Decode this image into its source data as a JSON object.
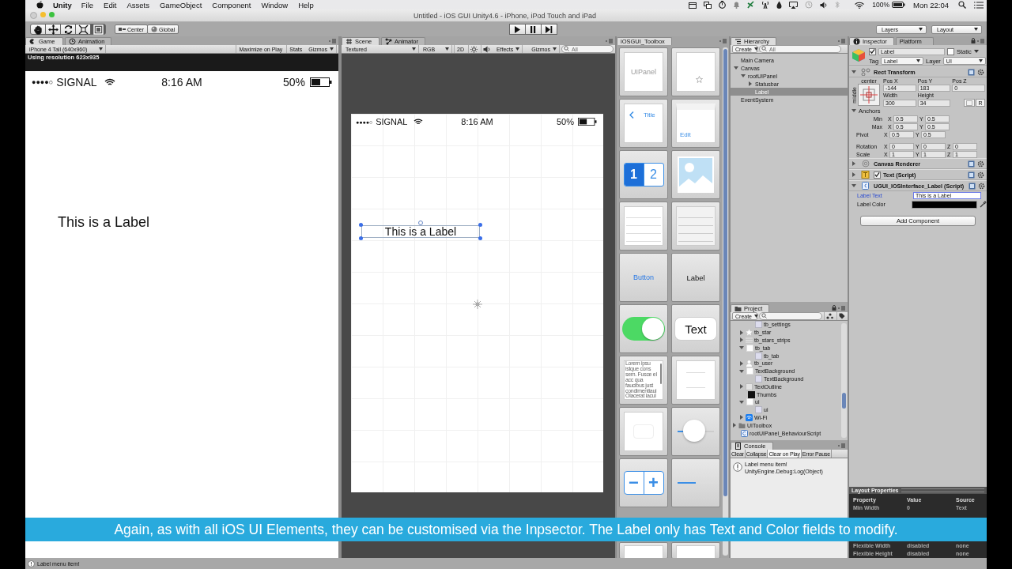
{
  "menubar": {
    "app": "Unity",
    "menus": [
      "File",
      "Edit",
      "Assets",
      "GameObject",
      "Component",
      "Window",
      "Help"
    ],
    "battery_text": "100%",
    "clock": "Mon 22:04"
  },
  "window": {
    "title": "Untitled - iOS GUI Unity4.6 - iPhone, iPod Touch and iPad"
  },
  "toolbar": {
    "tools": [
      {
        "kind": "hand",
        "selected": false
      },
      {
        "kind": "move",
        "selected": false
      },
      {
        "kind": "rotate",
        "selected": false
      },
      {
        "kind": "scale",
        "selected": false
      },
      {
        "kind": "rect",
        "selected": true
      }
    ],
    "pivot_buttons": [
      {
        "kind": "center",
        "label": "Center"
      },
      {
        "kind": "global",
        "label": "Global"
      }
    ],
    "playback": [
      {
        "kind": "play"
      },
      {
        "kind": "pause"
      },
      {
        "kind": "step"
      }
    ],
    "dropdowns": [
      "Layers",
      "Layout"
    ]
  },
  "game": {
    "tabs": [
      {
        "kind": "game",
        "label": "Game",
        "selected": true
      },
      {
        "kind": "animation",
        "label": "Animation",
        "selected": false
      }
    ],
    "resolution": "iPhone 4 Tall (640x960)",
    "buttons": [
      "Maximize on Play",
      "Stats"
    ],
    "gizmos": "Gizmos",
    "info": "Using resolution 623x935",
    "phone": {
      "signal_dots": "●●●●○",
      "carrier": "SIGNAL",
      "time": "8:16 AM",
      "battery": "50%",
      "label": "This is a Label"
    }
  },
  "scene": {
    "tabs": [
      {
        "kind": "scene",
        "label": "Scene",
        "selected": true
      },
      {
        "kind": "animator",
        "label": "Animator",
        "selected": false
      }
    ],
    "render_mode": "Textured",
    "channel": "RGB",
    "mode_button": "2D",
    "effects": "Effects",
    "gizmos": "Gizmos",
    "search_placeholder": "All",
    "phone": {
      "signal_dots": "●●●●○",
      "carrier": "SIGNAL",
      "time": "8:16 AM",
      "battery": "50%",
      "label": "This is a Label"
    }
  },
  "toolbox": {
    "tab": "iOSGUI_Toolbox",
    "tiles": [
      {
        "kind": "panel",
        "text": "UIPanel"
      },
      {
        "kind": "tabbar"
      },
      {
        "kind": "navbar",
        "text": "Title"
      },
      {
        "kind": "edit",
        "text": "Edit"
      },
      {
        "kind": "segmented",
        "texts": [
          "1",
          "2"
        ]
      },
      {
        "kind": "image"
      },
      {
        "kind": "table"
      },
      {
        "kind": "table_grey"
      },
      {
        "kind": "button",
        "text": "Button"
      },
      {
        "kind": "label",
        "text": "Label"
      },
      {
        "kind": "switch",
        "on": true
      },
      {
        "kind": "textfield",
        "text": "Text"
      },
      {
        "kind": "textview",
        "text": "Lorem ipsu istque cons sem. Fusce el acc qua faucibus just condimentiaui Olacerat iacul"
      },
      {
        "kind": "picker"
      },
      {
        "kind": "frame"
      },
      {
        "kind": "slider",
        "level": 0.45
      },
      {
        "kind": "stepper",
        "texts": [
          "−",
          "+"
        ]
      },
      {
        "kind": "progress",
        "level": 0.5
      },
      {
        "kind": "blank"
      },
      {
        "kind": "blank"
      }
    ]
  },
  "hierarchy": {
    "tab": "Hierarchy",
    "create": "Create",
    "search_placeholder": "All",
    "items": [
      {
        "label": "Main Camera",
        "selected": false
      },
      {
        "label": "Canvas",
        "selected": false,
        "expanded": true,
        "children": [
          {
            "label": "rootUIPanel",
            "selected": false,
            "expanded": true,
            "children": [
              {
                "label": "Statusbar",
                "selected": false,
                "expanded": false
              },
              {
                "label": "Label",
                "selected": true
              }
            ]
          }
        ]
      },
      {
        "label": "EventSystem",
        "selected": false
      }
    ]
  },
  "project": {
    "tab": "Project",
    "create": "Create",
    "scrolled_items": [
      {
        "kind": "sprite",
        "label": "tb_settings"
      },
      {
        "kind": "star",
        "label": "tb_star",
        "expanded": false
      },
      {
        "kind": "strips",
        "label": "tb_stars_strips",
        "expanded": false
      },
      {
        "kind": "texture",
        "label": "tb_tab",
        "expanded": true,
        "children": [
          {
            "kind": "sprite",
            "label": "tb_tab"
          }
        ]
      },
      {
        "kind": "user",
        "label": "tb_user",
        "expanded": false
      },
      {
        "kind": "texture",
        "label": "TextBackground",
        "expanded": true,
        "children": [
          {
            "kind": "sprite",
            "label": "TextBackground"
          }
        ]
      },
      {
        "kind": "outline",
        "label": "TextOutline",
        "expanded": false
      },
      {
        "kind": "black",
        "label": "Thumbs"
      },
      {
        "kind": "texture",
        "label": "ui",
        "expanded": true,
        "children": [
          {
            "kind": "sprite",
            "label": "ui"
          }
        ]
      },
      {
        "kind": "wifi",
        "label": "Wi-Fi",
        "expanded": false
      }
    ],
    "items": [
      {
        "kind": "folder",
        "label": "UIToolbox",
        "expanded": false
      },
      {
        "kind": "script",
        "label": "rootUIPanel_BehaviourScript"
      }
    ]
  },
  "console": {
    "tab": "Console",
    "buttons": [
      {
        "label": "Clear",
        "selected": false
      },
      {
        "label": "Collapse",
        "selected": false
      },
      {
        "label": "Clear on Play",
        "selected": true
      },
      {
        "label": "Error Pause",
        "selected": false
      }
    ],
    "entries": [
      {
        "lines": [
          "Label menu item!",
          "UnityEngine.Debug:Log(Object)"
        ]
      }
    ]
  },
  "inspector": {
    "tabs": [
      {
        "kind": "inspector",
        "label": "Inspector",
        "selected": true
      },
      {
        "kind": "platform",
        "label": "Platform",
        "selected": false
      }
    ],
    "active": true,
    "name": "Label",
    "static": {
      "label": "Static",
      "checked": false
    },
    "tag_label": "Tag",
    "tag": "Label",
    "layer_label": "Layer",
    "layer": "UI",
    "rect_transform": {
      "title": "Rect Transform",
      "expanded": true,
      "anchor_h": "center",
      "anchor_v": "middle",
      "fields": [
        {
          "label": "Pos X",
          "value": "-144"
        },
        {
          "label": "Pos Y",
          "value": "183"
        },
        {
          "label": "Pos Z",
          "value": "0"
        },
        {
          "label": "Width",
          "value": "300"
        },
        {
          "label": "Height",
          "value": "34"
        }
      ],
      "r_button": "R",
      "anchors_title": "Anchors",
      "anchors_expanded": true,
      "rows": [
        {
          "label": "Min",
          "fields": [
            {
              "axis": "X",
              "value": "0.5"
            },
            {
              "axis": "Y",
              "value": "0.5"
            }
          ]
        },
        {
          "label": "Max",
          "fields": [
            {
              "axis": "X",
              "value": "0.5"
            },
            {
              "axis": "Y",
              "value": "0.5"
            }
          ]
        },
        {
          "label": "Pivot",
          "fields": [
            {
              "axis": "X",
              "value": "0.5"
            },
            {
              "axis": "Y",
              "value": "0.5"
            }
          ]
        },
        {
          "label": "Rotation",
          "fields": [
            {
              "axis": "X",
              "value": "0"
            },
            {
              "axis": "Y",
              "value": "0"
            },
            {
              "axis": "Z",
              "value": "0"
            }
          ]
        },
        {
          "label": "Scale",
          "fields": [
            {
              "axis": "X",
              "value": "1"
            },
            {
              "axis": "Y",
              "value": "1"
            },
            {
              "axis": "Z",
              "value": "1"
            }
          ]
        }
      ]
    },
    "components": [
      {
        "kind": "renderer",
        "title": "Canvas Renderer",
        "expanded": false
      },
      {
        "kind": "text",
        "title": "Text (Script)",
        "expanded": false,
        "enabled": true
      },
      {
        "kind": "script",
        "title": "UGUI_IOSInterface_Label (Script)",
        "expanded": true,
        "properties": [
          {
            "kind": "text",
            "label": "Label Text",
            "value": "This is a Label",
            "focused": true
          },
          {
            "kind": "color",
            "label": "Label Color",
            "color": "#000000",
            "focused": false
          }
        ]
      }
    ],
    "add_component": "Add Component",
    "layout_properties": {
      "title": "Layout Properties",
      "columns": [
        "Property",
        "Value",
        "Source"
      ],
      "top_rows": [
        [
          "Min Width",
          "0",
          "Text"
        ]
      ],
      "bottom_rows": [
        [
          "Flexible Width",
          "disabled",
          "none"
        ],
        [
          "Flexible Height",
          "disabled",
          "none"
        ]
      ]
    }
  },
  "caption": "Again, as with all iOS UI Elements, they can be customised via the Inpsector. The Label only has Text and Color fields to modify.",
  "status_bar": {
    "message": "Label menu item!"
  }
}
